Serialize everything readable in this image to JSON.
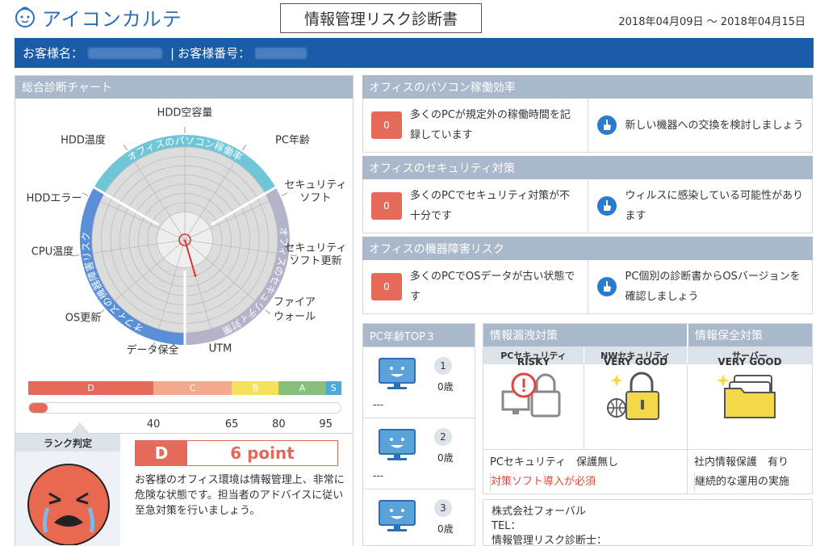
{
  "header": {
    "logo_text": "アイコンカルテ",
    "doc_title": "情報管理リスク診断書",
    "date_range": "2018年04月09日 ～ 2018年04月15日"
  },
  "customer": {
    "name_label": "お客様名：",
    "separator": "|",
    "number_label": "お客様番号："
  },
  "chart": {
    "panel_title": "総合診断チャート",
    "axis_labels": [
      "HDD空容量",
      "PC年齢",
      "セキュリティソフト",
      "セキュリティソフト更新",
      "ファイアウォール",
      "UTM",
      "データ保全",
      "OS更新",
      "CPU温度",
      "HDDエラー",
      "HDD温度"
    ],
    "sector_labels": [
      "オフィスのパソコン稼働率",
      "オフィスのセキュリティ対策",
      "オフィスの機器障害リスク"
    ]
  },
  "chart_data": {
    "type": "radar",
    "categories": [
      "HDD空容量",
      "PC年齢",
      "セキュリティソフト",
      "セキュリティソフト更新",
      "ファイアウォール",
      "UTM",
      "データ保全",
      "OS更新",
      "CPU温度",
      "HDDエラー",
      "HDD温度"
    ],
    "values": [
      0,
      0,
      0,
      0,
      0,
      4,
      0,
      0,
      0,
      0,
      0
    ],
    "range": [
      0,
      10
    ],
    "grid": true
  },
  "rank": {
    "scale": [
      "D",
      "C",
      "B",
      "A",
      "S"
    ],
    "scale_colors": [
      "#e56a5a",
      "#f3a98b",
      "#f3e25a",
      "#86c07a",
      "#4fa9d8"
    ],
    "progress_value": 6,
    "progress_max": 100,
    "ticks": [
      "40",
      "65",
      "80",
      "95"
    ],
    "tick_values": [
      40,
      65,
      80,
      95
    ],
    "label": "ランク判定",
    "grade": "D",
    "point": "6 point",
    "description": "お客様のオフィス環境は情報管理上、非常に危険な状態です。担当者のアドバイスに従い至急対策を行いましょう。"
  },
  "sections": [
    {
      "title": "オフィスのパソコン稼働効率",
      "count": "0",
      "problem": "多くのPCが規定外の稼働時間を記録しています",
      "advice": "新しい機器への交換を検討しましょう"
    },
    {
      "title": "オフィスのセキュリティ対策",
      "count": "0",
      "problem": "多くのPCでセキュリティ対策が不十分です",
      "advice": "ウィルスに感染している可能性があります"
    },
    {
      "title": "オフィスの機器障害リスク",
      "count": "0",
      "problem": "多くのPCでOSデータが古い状態です",
      "advice": "PC個別の診断書からOSバージョンを確認しましょう"
    }
  ],
  "pc_age": {
    "title": "PC年齢TOP３",
    "items": [
      {
        "rank": "1",
        "age": "0歳",
        "name": "---"
      },
      {
        "rank": "2",
        "age": "0歳",
        "name": "---"
      },
      {
        "rank": "3",
        "age": "0歳",
        "name": ""
      }
    ]
  },
  "leak": {
    "title": "情報漏洩対策",
    "preserve_title": "情報保全対策",
    "pc_security": "PCセキュリティ",
    "nw_security": "NWセキュリティ",
    "server": "サーバー",
    "pc_status": "RISKY",
    "nw_status": "VERY GOOD",
    "server_status": "VERY GOOD",
    "pc_note": "PCセキュリティ　保護無し",
    "pc_warning": "対策ソフト導入が必須",
    "preserve_note1": "社内情報保護　有り",
    "preserve_note2": "継続的な運用の実施"
  },
  "company": {
    "name": "株式会社フォーバル",
    "tel": "TEL：",
    "diagnostician": "情報管理リスク診断士："
  }
}
